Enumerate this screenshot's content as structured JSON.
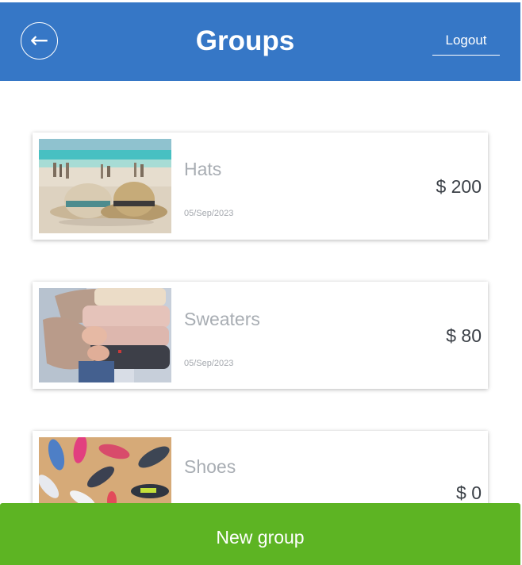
{
  "header": {
    "title": "Groups",
    "logout_label": "Logout",
    "back_icon": "←"
  },
  "groups": [
    {
      "name": "Hats",
      "date": "05/Sep/2023",
      "price": "$ 200",
      "image": "hats-on-beach"
    },
    {
      "name": "Sweaters",
      "date": "05/Sep/2023",
      "price": "$ 80",
      "image": "stack-of-sweaters"
    },
    {
      "name": "Shoes",
      "date": "",
      "price": "$ 0",
      "image": "sneakers-on-sand"
    }
  ],
  "footer": {
    "new_group_label": "New group"
  },
  "colors": {
    "header_bg": "#3677c6",
    "button_bg": "#5db423"
  }
}
